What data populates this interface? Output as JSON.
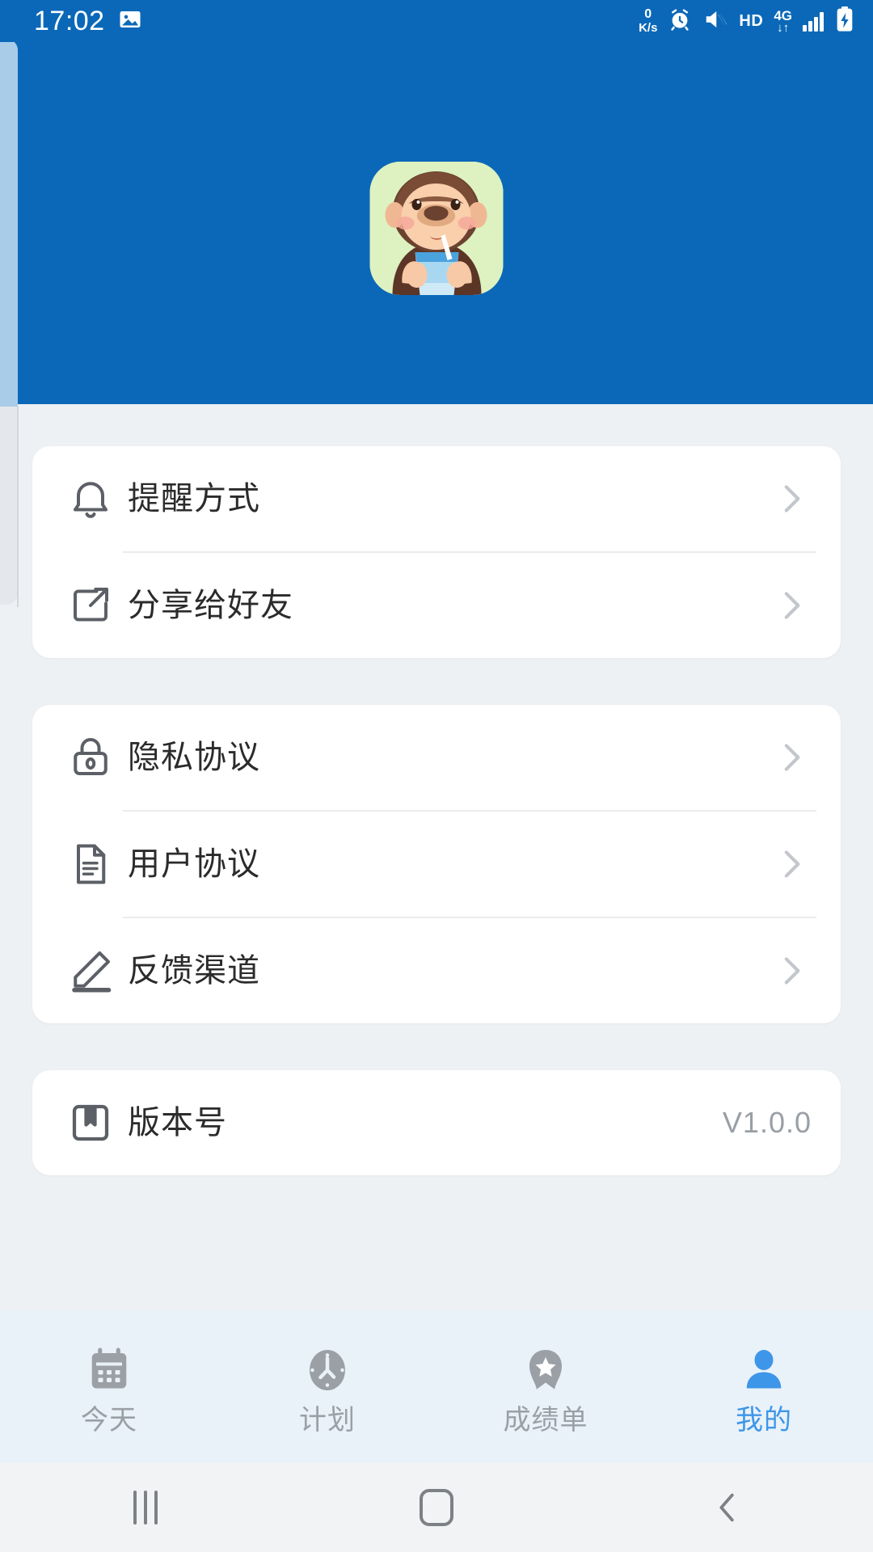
{
  "status_bar": {
    "time": "17:02",
    "gallery_icon": "image-icon",
    "net_speed_value": "0",
    "net_speed_unit": "K/s",
    "alarm_icon": "alarm-icon",
    "mute_icon": "mute-icon",
    "hd_label": "HD",
    "network_type": "4G",
    "network_arrows": "↓↑",
    "signal_icon": "signal-bars-icon",
    "battery_icon": "battery-charging-icon"
  },
  "header": {
    "app_icon": "monkey-drinking-water-icon",
    "background_color": "#0b68b8"
  },
  "sections": [
    {
      "name": "settings-card",
      "rows": [
        {
          "icon": "bell-icon",
          "label": "提醒方式",
          "accessory": "chevron-right-icon"
        },
        {
          "icon": "share-icon",
          "label": "分享给好友",
          "accessory": "chevron-right-icon"
        }
      ]
    },
    {
      "name": "legal-card",
      "rows": [
        {
          "icon": "lock-icon",
          "label": "隐私协议",
          "accessory": "chevron-right-icon"
        },
        {
          "icon": "document-icon",
          "label": "用户协议",
          "accessory": "chevron-right-icon"
        },
        {
          "icon": "pencil-icon",
          "label": "反馈渠道",
          "accessory": "chevron-right-icon"
        }
      ]
    },
    {
      "name": "version-card",
      "rows": [
        {
          "icon": "bookmark-icon",
          "label": "版本号",
          "value": "V1.0.0"
        }
      ]
    }
  ],
  "tabbar": {
    "active_color": "#3d96e8",
    "inactive_color": "#9aa0a6",
    "tabs": [
      {
        "icon": "calendar-icon",
        "label": "今天",
        "active": false
      },
      {
        "icon": "clock-icon",
        "label": "计划",
        "active": false
      },
      {
        "icon": "badge-star-icon",
        "label": "成绩单",
        "active": false
      },
      {
        "icon": "person-icon",
        "label": "我的",
        "active": true
      }
    ]
  },
  "navbar": {
    "recents": "recents-icon",
    "home": "home-icon",
    "back": "back-icon"
  }
}
